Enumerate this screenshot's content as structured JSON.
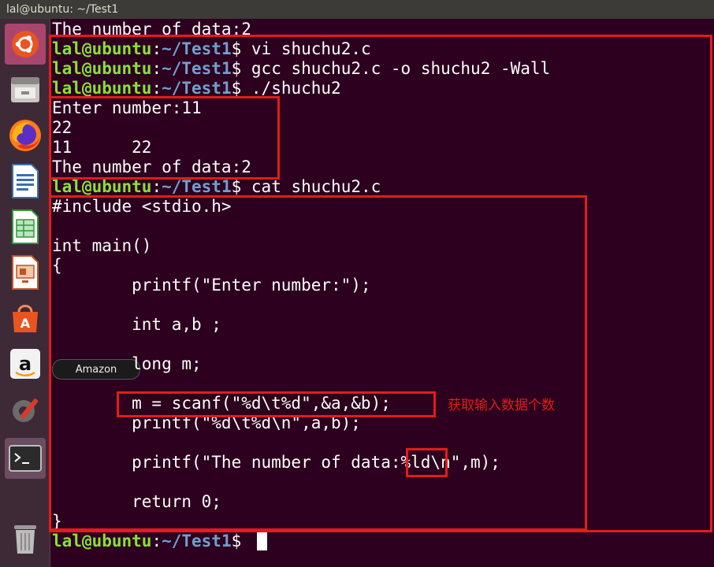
{
  "window": {
    "title": "lal@ubuntu: ~/Test1"
  },
  "launcher": {
    "tooltip": "Amazon",
    "items": [
      {
        "name": "ubuntu-dash-icon"
      },
      {
        "name": "files-icon"
      },
      {
        "name": "firefox-icon"
      },
      {
        "name": "libreoffice-writer-icon"
      },
      {
        "name": "libreoffice-calc-icon"
      },
      {
        "name": "libreoffice-impress-icon"
      },
      {
        "name": "software-center-icon"
      },
      {
        "name": "amazon-icon"
      },
      {
        "name": "system-settings-icon"
      },
      {
        "name": "terminal-icon"
      },
      {
        "name": "trash-icon"
      }
    ]
  },
  "prompt": {
    "user": "lal@ubuntu",
    "path": "~/Test1",
    "symbol": "$"
  },
  "terminal": {
    "line0": "The number of data:2",
    "cmd1": " vi shuchu2.c",
    "cmd2": " gcc shuchu2.c -o shuchu2 -Wall",
    "cmd3": " ./shuchu2",
    "out1": "Enter number:11",
    "out2": "22",
    "out3": "11      22",
    "out4": "The number of data:2",
    "cmd4": " cat shuchu2.c",
    "src": [
      "#include <stdio.h>",
      "",
      "int main()",
      "{",
      "        printf(\"Enter number:\");",
      "",
      "        int a,b ;",
      "",
      "        long m;",
      "",
      "        m = scanf(\"%d\\t%d\",&a,&b);",
      "        printf(\"%d\\t%d\\n\",a,b);",
      "",
      "        printf(\"The number of data:%ld\\n\",m);",
      "",
      "        return 0;",
      "}"
    ]
  },
  "annotation": {
    "text": "获取输入数据个数",
    "color": "#e41b1b"
  }
}
